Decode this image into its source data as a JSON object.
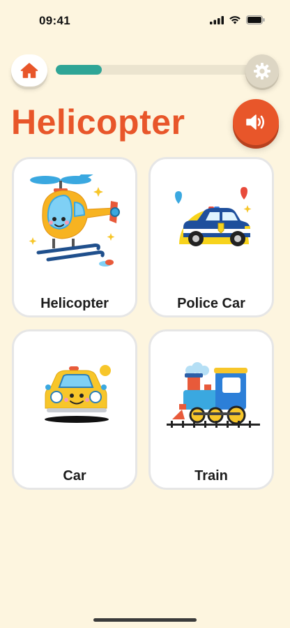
{
  "status_bar": {
    "time": "09:41"
  },
  "header": {
    "progress_fraction": 0.22,
    "title": "Helicopter"
  },
  "cards": [
    {
      "label": "Helicopter",
      "icon": "helicopter-icon"
    },
    {
      "label": "Police Car",
      "icon": "police-car-icon"
    },
    {
      "label": "Car",
      "icon": "car-icon"
    },
    {
      "label": "Train",
      "icon": "train-icon"
    }
  ],
  "colors": {
    "background": "#fdf5df",
    "accent": "#e8562a",
    "progress": "#2fa596"
  }
}
